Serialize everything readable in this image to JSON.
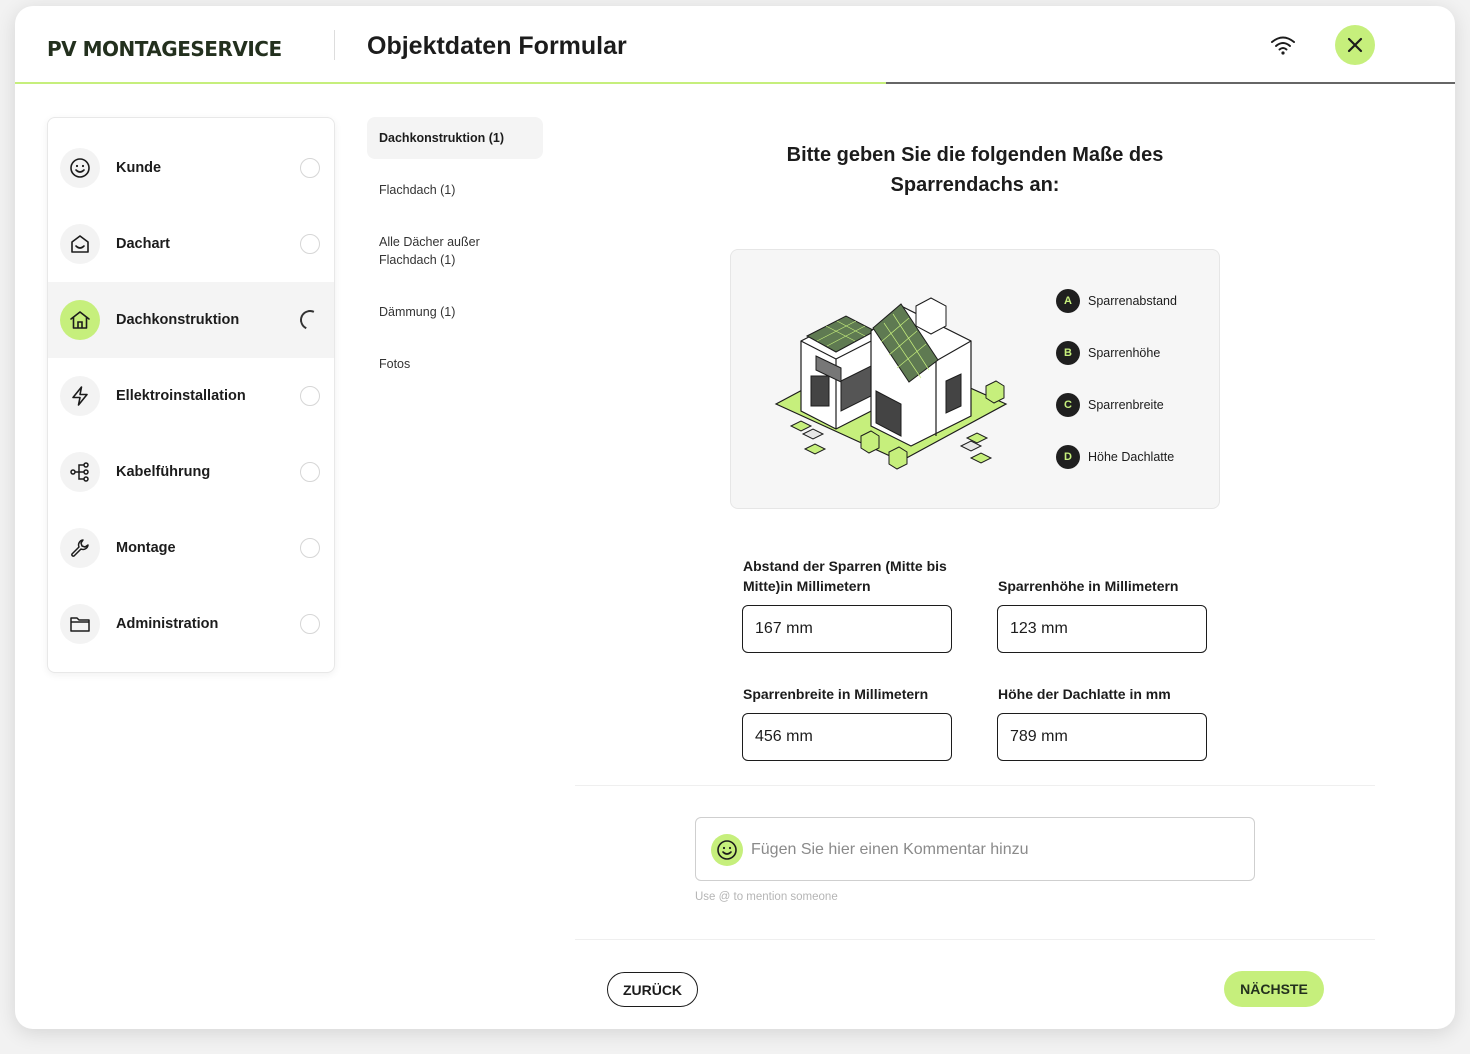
{
  "header": {
    "logo": "PV MONTAGESERVICE",
    "title": "Objektdaten Formular"
  },
  "progress": {
    "fraction": 0.605
  },
  "sidebar": {
    "items": [
      {
        "label": "Kunde",
        "icon": "smiley-icon",
        "status": "empty"
      },
      {
        "label": "Dachart",
        "icon": "roof-house-icon",
        "status": "empty"
      },
      {
        "label": "Dachkonstruktion",
        "icon": "home-icon",
        "status": "loading",
        "active": true
      },
      {
        "label": "Ellektroinstallation",
        "icon": "lightning-icon",
        "status": "empty"
      },
      {
        "label": "Kabelführung",
        "icon": "cable-routing-icon",
        "status": "empty"
      },
      {
        "label": "Montage",
        "icon": "wrench-icon",
        "status": "empty"
      },
      {
        "label": "Administration",
        "icon": "folder-icon",
        "status": "empty"
      }
    ]
  },
  "subnav": {
    "items": [
      {
        "label": "Dachkonstruktion (1)",
        "active": true
      },
      {
        "label": "Flachdach (1)"
      },
      {
        "label": "Alle Dächer außer Flachdach (1)"
      },
      {
        "label": "Dämmung (1)"
      },
      {
        "label": "Fotos"
      }
    ]
  },
  "main": {
    "question": "Bitte geben Sie die folgenden Maße des Sparrendachs an:",
    "legend": [
      {
        "badge": "A",
        "label": "Sparrenabstand"
      },
      {
        "badge": "B",
        "label": "Sparrenhöhe"
      },
      {
        "badge": "C",
        "label": "Sparrenbreite"
      },
      {
        "badge": "D",
        "label": "Höhe Dachlatte"
      }
    ],
    "fields": {
      "abstand": {
        "label": "Abstand der Sparren (Mitte bis Mitte)in Millimetern",
        "value": "167 mm"
      },
      "hoehe": {
        "label": "Sparrenhöhe in Millimetern",
        "value": "123 mm"
      },
      "breite": {
        "label": "Sparrenbreite in Millimetern",
        "value": "456 mm"
      },
      "dachlatte": {
        "label": "Höhe der Dachlatte in mm",
        "value": "789 mm"
      }
    },
    "comment": {
      "placeholder": "Fügen Sie hier einen Kommentar hinzu",
      "hint": "Use @ to mention someone"
    }
  },
  "footer": {
    "back_label": "ZURÜCK",
    "next_label": "NÄCHSTE"
  },
  "colors": {
    "accent": "#c6ef7c",
    "dark": "#1c1c1c",
    "logo": "#23301e"
  }
}
